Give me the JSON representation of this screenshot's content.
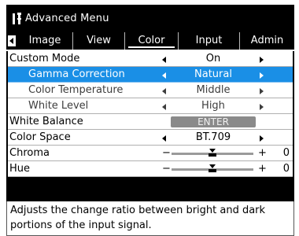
{
  "header": {
    "title": "Advanced Menu",
    "icon": "tools-icon"
  },
  "tabs": [
    {
      "label": "Image",
      "active": false
    },
    {
      "label": "View",
      "active": false
    },
    {
      "label": "Color",
      "active": true
    },
    {
      "label": "Input",
      "active": false
    },
    {
      "label": "Admin",
      "active": false
    }
  ],
  "rows": {
    "custom_mode": {
      "label": "Custom Mode",
      "value": "On"
    },
    "gamma": {
      "label": "Gamma Correction",
      "value": "Natural"
    },
    "color_temp": {
      "label": "Color Temperature",
      "value": "Middle"
    },
    "white_level": {
      "label": "White Level",
      "value": "High"
    },
    "white_balance": {
      "label": "White Balance",
      "button": "ENTER"
    },
    "color_space": {
      "label": "Color Space",
      "value": "BT.709"
    },
    "chroma": {
      "label": "Chroma",
      "value": "0",
      "minus": "−",
      "plus": "+",
      "level": 0.5
    },
    "hue": {
      "label": "Hue",
      "value": "0",
      "minus": "−",
      "plus": "+",
      "level": 0.5
    }
  },
  "help": {
    "text": "Adjusts the change ratio between bright and dark portions of the input signal."
  },
  "colors": {
    "selected": "#1a8fe6",
    "background": "#000000",
    "row": "#ffffff",
    "button": "#8a8a8a"
  }
}
